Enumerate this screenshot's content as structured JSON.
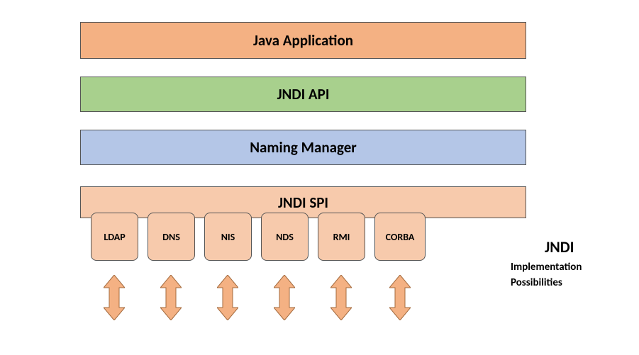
{
  "layers": {
    "app": "Java Application",
    "api": "JNDI API",
    "naming": "Naming Manager",
    "spi": "JNDI SPI"
  },
  "providers": [
    "LDAP",
    "DNS",
    "NIS",
    "NDS",
    "RMI",
    "CORBA"
  ],
  "sidebar": {
    "title": "JNDI",
    "line1": "Implementation",
    "line2": "Possibilities"
  },
  "colors": {
    "peach": "#f4b183",
    "green": "#a8d08d",
    "blue": "#b4c6e7",
    "lightPeach": "#f7caac"
  }
}
